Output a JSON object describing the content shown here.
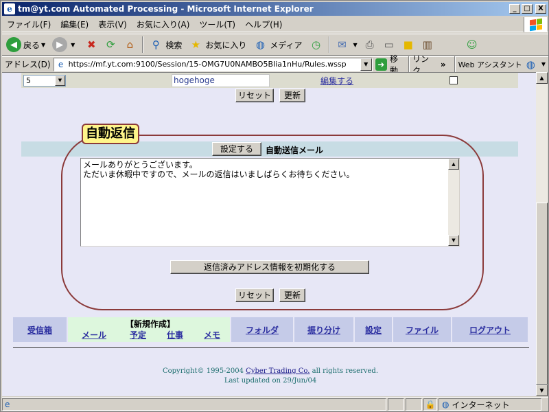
{
  "window": {
    "title": "tm@yt.com Automated Processing - Microsoft Internet Explorer",
    "buttons": {
      "minimize": "_",
      "maximize": "□",
      "close": "X"
    }
  },
  "menu": [
    "ファイル(F)",
    "編集(E)",
    "表示(V)",
    "お気に入り(A)",
    "ツール(T)",
    "ヘルプ(H)"
  ],
  "toolbar": {
    "back": "戻る",
    "search": "検索",
    "favorites": "お気に入り",
    "media": "メディア"
  },
  "address": {
    "label": "アドレス(D)",
    "url": "https://mf.yt.com:9100/Session/15-OMG7U0NAMBO5BIia1nHu/Rules.wssp",
    "go": "移動",
    "links": "リンク",
    "links_more": "»",
    "assistant": "Web アシスタント"
  },
  "rules_row": {
    "select_value": "5",
    "text_value": "hogehoge",
    "edit_link": "編集する"
  },
  "buttons": {
    "reset": "リセット",
    "update": "更新",
    "set": "設定する",
    "init_address": "返信済みアドレス情報を初期化する"
  },
  "auto_reply": {
    "callout": "自動返信",
    "header": "自動送信メール",
    "message_lines": [
      "メールありがとうございます。",
      "ただいま休暇中ですので、メールの返信はいましばらくお待ちください。"
    ]
  },
  "nav": {
    "inbox": "受信箱",
    "new_header": "【新規作成】",
    "new_mail": "メール",
    "new_schedule": "予定",
    "new_task": "仕事",
    "new_memo": "メモ",
    "folder": "フォルダ",
    "sort": "振り分け",
    "settings": "設定",
    "file": "ファイル",
    "logout": "ログアウト"
  },
  "footer": {
    "copyright_pre": "Copyright© 1995-2004 ",
    "company": "Cyber Trading Co.",
    "copyright_post": " all rights reserved.",
    "updated": "Last updated on 29/Jun/04"
  },
  "status": {
    "zone": "インターネット"
  },
  "colors": {
    "titlebar": "#0a246a",
    "page_bg": "#e7e7f6",
    "nav_bg": "#c5cbe8",
    "nav_new_bg": "#ddf7dd",
    "header_band": "#c7dce4",
    "oval": "#8b3a3a",
    "callout_bg": "#fff58a",
    "link": "#2b2ea0"
  }
}
